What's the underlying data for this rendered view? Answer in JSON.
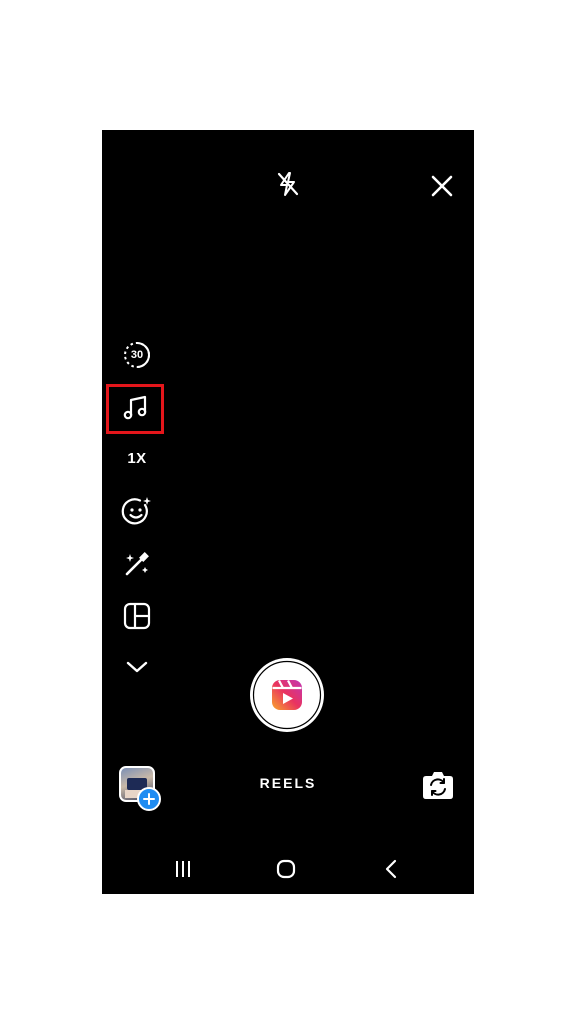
{
  "top_bar": {
    "flash_icon": "flash-off-icon",
    "close_icon": "close-icon"
  },
  "side_tools": {
    "timer_value": "30",
    "music_icon": "music-note-icon",
    "speed_label": "1X",
    "effects_icon": "face-sparkle-icon",
    "touch_up_icon": "magic-wand-icon",
    "layout_icon": "layout-grid-icon",
    "more_icon": "chevron-down-icon"
  },
  "bottom": {
    "mode_label": "REELS",
    "gallery_icon": "gallery-thumbnail",
    "flip_icon": "flip-camera-icon",
    "shutter_icon": "reels-record-button"
  },
  "nav_bar": {
    "recents_icon": "recents-icon",
    "home_icon": "home-icon",
    "back_icon": "back-icon"
  },
  "colors": {
    "background": "#000000",
    "highlight": "#e5161b",
    "badge_blue": "#1f8cf2"
  }
}
